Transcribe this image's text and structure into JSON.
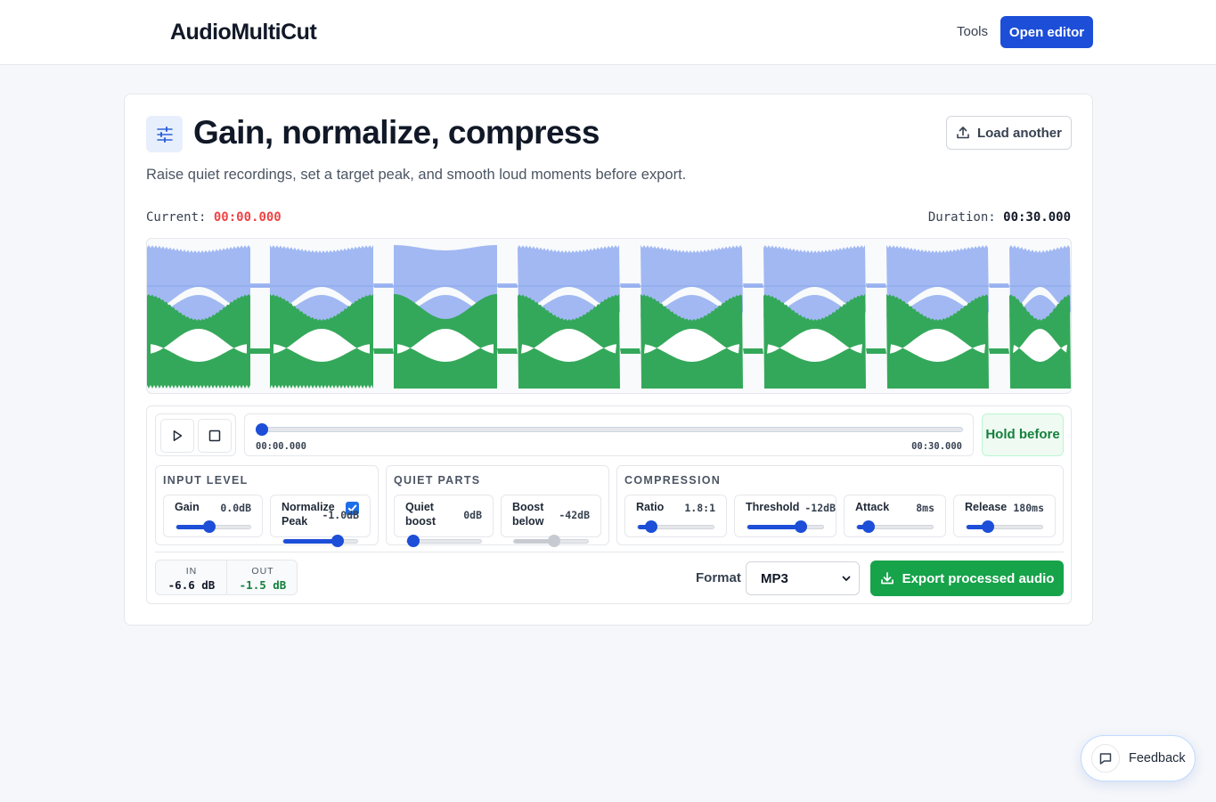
{
  "brand": {
    "name": "AudioMultiCut"
  },
  "nav": {
    "tools": "Tools",
    "open_editor": "Open editor"
  },
  "page": {
    "title": "Gain, normalize, compress",
    "subtitle": "Raise quiet recordings, set a target peak, and smooth loud moments before export.",
    "load_another": "Load another"
  },
  "time": {
    "current_label": "Current:",
    "current_value": "00:00.000",
    "duration_label": "Duration:",
    "duration_value": "00:30.000"
  },
  "playback": {
    "position_fraction": 0,
    "start": "00:00.000",
    "end": "00:30.000",
    "hold_label": "Hold before"
  },
  "groups": {
    "input_level": {
      "title": "INPUT LEVEL",
      "gain": {
        "label": "Gain",
        "value": "0.0dB",
        "fraction": 0.43
      },
      "normalize": {
        "label": "Normalize Peak",
        "value": "-1.0dB",
        "checked": true,
        "fraction": 0.78
      }
    },
    "quiet_parts": {
      "title": "QUIET PARTS",
      "quiet_boost": {
        "label": "Quiet boost",
        "value": "0dB",
        "fraction": 0.0
      },
      "boost_below": {
        "label": "Boost below",
        "value": "-42dB",
        "fraction": 0.55,
        "disabled": true
      }
    },
    "compression": {
      "title": "COMPRESSION",
      "ratio": {
        "label": "Ratio",
        "value": "1.8:1",
        "fraction": 0.11
      },
      "threshold": {
        "label": "Threshold",
        "value": "-12dB",
        "fraction": 0.75
      },
      "attack": {
        "label": "Attack",
        "value": "8ms",
        "fraction": 0.08
      },
      "release": {
        "label": "Release",
        "value": "180ms",
        "fraction": 0.24
      }
    }
  },
  "meter": {
    "in_label": "IN",
    "in_value": "-6.6 dB",
    "out_label": "OUT",
    "out_value": "-1.5 dB"
  },
  "export": {
    "format_label": "Format",
    "format_value": "MP3",
    "button": "Export processed audio"
  },
  "feedback": {
    "label": "Feedback"
  },
  "colors": {
    "accent": "#1d4ed8",
    "export_green": "#16a34a",
    "current_time_red": "#ef4444",
    "waveform_before": "#a1b8f2",
    "waveform_after": "#34a85a"
  },
  "icons": {
    "brand": "audio-waveform-icon",
    "title": "sliders-icon",
    "load": "upload-icon",
    "play": "play-icon",
    "stop": "stop-icon",
    "export": "download-icon",
    "feedback": "message-icon"
  }
}
